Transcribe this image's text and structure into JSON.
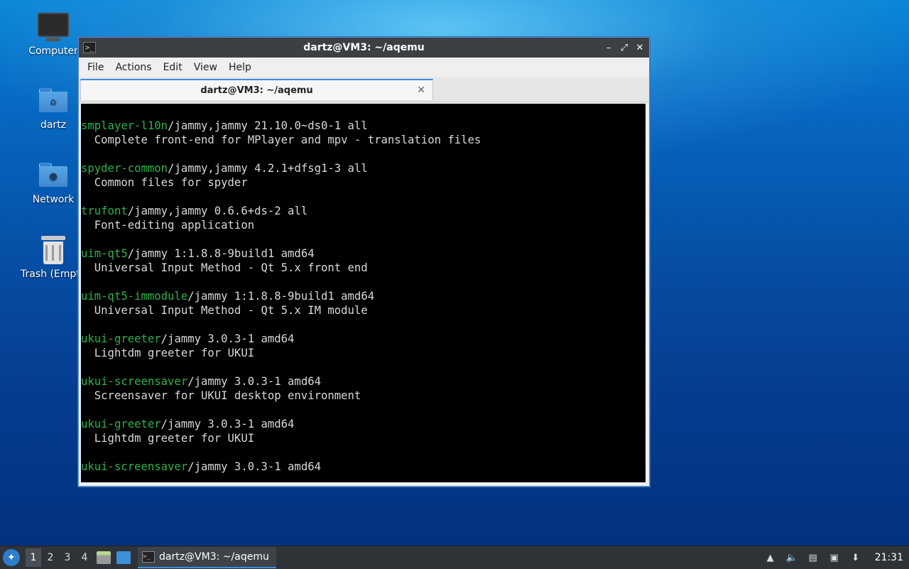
{
  "desktop": {
    "icons": [
      {
        "label": "Computer"
      },
      {
        "label": "dartz"
      },
      {
        "label": "Network"
      },
      {
        "label": "Trash (Empty)"
      }
    ]
  },
  "window": {
    "title": "dartz@VM3: ~/aqemu",
    "menu": [
      "File",
      "Actions",
      "Edit",
      "View",
      "Help"
    ],
    "tab_title": "dartz@VM3: ~/aqemu"
  },
  "terminal": {
    "entries": [
      {
        "pkg": "smplayer-l10n",
        "rest": "/jammy,jammy 21.10.0~ds0-1 all",
        "desc": "  Complete front-end for MPlayer and mpv - translation files"
      },
      {
        "pkg": "spyder-common",
        "rest": "/jammy,jammy 4.2.1+dfsg1-3 all",
        "desc": "  Common files for spyder"
      },
      {
        "pkg": "trufont",
        "rest": "/jammy,jammy 0.6.6+ds-2 all",
        "desc": "  Font-editing application"
      },
      {
        "pkg": "uim-qt5",
        "rest": "/jammy 1:1.8.8-9build1 amd64",
        "desc": "  Universal Input Method - Qt 5.x front end"
      },
      {
        "pkg": "uim-qt5-immodule",
        "rest": "/jammy 1:1.8.8-9build1 amd64",
        "desc": "  Universal Input Method - Qt 5.x IM module"
      },
      {
        "pkg": "ukui-greeter",
        "rest": "/jammy 3.0.3-1 amd64",
        "desc": "  Lightdm greeter for UKUI"
      },
      {
        "pkg": "ukui-screensaver",
        "rest": "/jammy 3.0.3-1 amd64",
        "desc": "  Screensaver for UKUI desktop environment"
      },
      {
        "pkg": "ukui-greeter",
        "rest": "/jammy 3.0.3-1 amd64",
        "desc": "  Lightdm greeter for UKUI"
      },
      {
        "pkg": "ukui-screensaver",
        "rest": "/jammy 3.0.3-1 amd64",
        "desc": ""
      }
    ]
  },
  "taskbar": {
    "workspaces": [
      "1",
      "2",
      "3",
      "4"
    ],
    "active_workspace": "1",
    "task_label": "dartz@VM3: ~/aqemu",
    "clock": "21:31"
  },
  "colors": {
    "package_name": "#2cb24a",
    "accent": "#3a8ee0"
  }
}
